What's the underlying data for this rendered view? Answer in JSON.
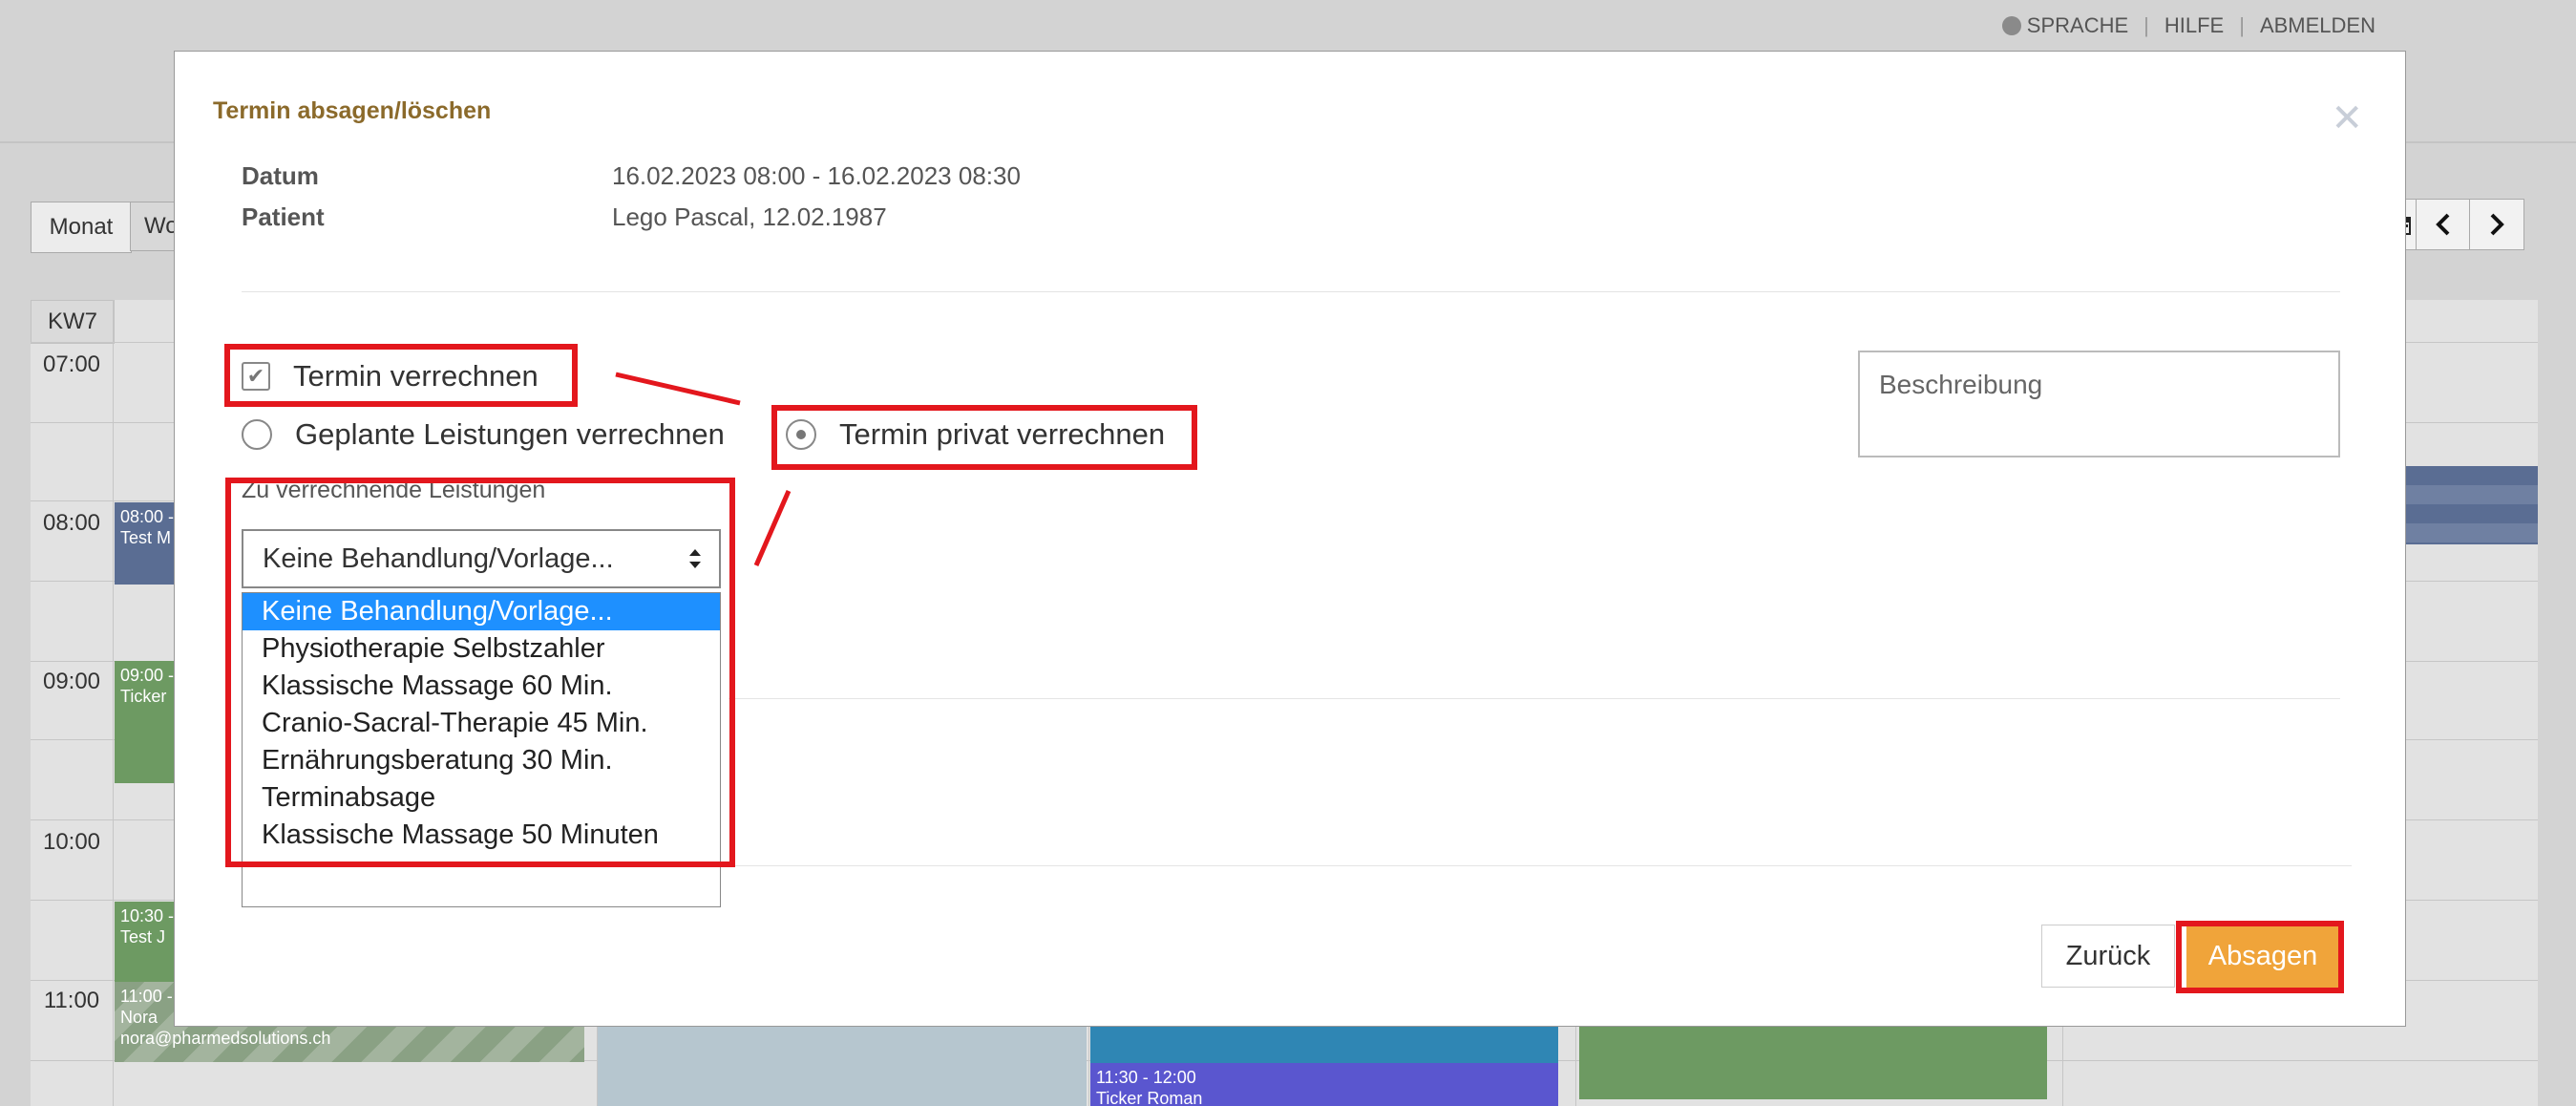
{
  "topbar": {
    "icon": "globe-icon",
    "language": "SPRACHE",
    "help": "HILFE",
    "logout": "ABMELDEN"
  },
  "calendar": {
    "view_month": "Monat",
    "view_week_partial": "Wo",
    "week_label": "KW7",
    "hours": [
      "07:00",
      "08:00",
      "09:00",
      "10:00",
      "11:00"
    ],
    "events": [
      {
        "time": "08:00 -",
        "title": "Test M",
        "color": "#5a6d93"
      },
      {
        "time": "09:00 -",
        "title": "Ticker",
        "color": "#6d9a62"
      },
      {
        "time": "10:30 -",
        "title": "Test J",
        "color": "#6d9a62"
      },
      {
        "time": "11:00 -",
        "title": "Nora",
        "extra": "nora@pharmedsolutions.ch",
        "color": "#8aa184"
      },
      {
        "time": "11:30 - 12:00",
        "title": "Ticker Roman",
        "color": "#5a56cf"
      }
    ]
  },
  "dialog": {
    "title": "Termin absagen/löschen",
    "close_icon": "close-icon",
    "date_label": "Datum",
    "date_value": "16.02.2023 08:00 - 16.02.2023 08:30",
    "patient_label": "Patient",
    "patient_value": "Lego Pascal, 12.02.1987",
    "checkbox_bill": "Termin verrechnen",
    "radio_planned": "Geplante Leistungen verrechnen",
    "radio_private": "Termin privat verrechnen",
    "services_label": "Zu verrechnende Leistungen",
    "select_value": "Keine Behandlung/Vorlage...",
    "options": [
      "Keine Behandlung/Vorlage...",
      "Physiotherapie Selbstzahler",
      "Klassische Massage 60 Min.",
      "Cranio-Sacral-Therapie 45 Min.",
      "Ernährungsberatung 30 Min.",
      "Terminabsage",
      "Klassische Massage 50 Minuten"
    ],
    "description_placeholder": "Beschreibung",
    "back_button": "Zurück",
    "cancel_button": "Absagen"
  },
  "colors": {
    "accent_title": "#8b6a2b",
    "highlight": "#e3171d",
    "primary_button": "#f0a43a",
    "selected_option": "#1e90ff"
  }
}
